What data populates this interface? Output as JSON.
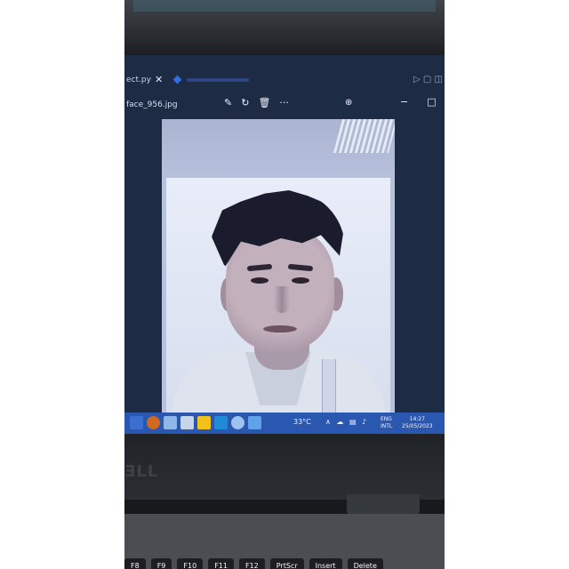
{
  "screen": {
    "tab": {
      "label": "ect.py",
      "close_glyph": "✕"
    },
    "viewer": {
      "file_name": "face_956.jpg",
      "toolbar_icons": [
        "edit-icon",
        "rotate-icon",
        "delete-icon",
        "more-icon"
      ],
      "more_glyph": "···",
      "zoom_glyph": "⊕",
      "minimize_glyph": "−",
      "maximize_glyph": "□"
    },
    "taskbar": {
      "temperature": "33°C",
      "tray_glyphs": "∧ ☁ ▤ ♪",
      "lang": "ENG",
      "lang_region": "INTL",
      "time": "14:27",
      "date": "25/05/2023"
    }
  },
  "laptop": {
    "brand": "ƎLL"
  },
  "keyboard": {
    "keys": [
      "F8",
      "F9",
      "F10",
      "F11",
      "F12",
      "PrtScr",
      "Insert",
      "Delete"
    ]
  },
  "colors": {
    "taskbar": "#2a57b0",
    "screen_bg": "#1e2b45",
    "hair": "#1a1c2d"
  }
}
